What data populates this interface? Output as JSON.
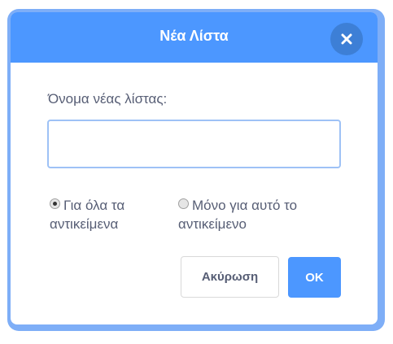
{
  "dialog": {
    "title": "Νέα Λίστα",
    "close_icon": "close-icon",
    "name_label": "Όνομα νέας λίστας:",
    "name_input": {
      "value": "",
      "placeholder": ""
    },
    "options": [
      {
        "label": "Για όλα τα αντικείμενα",
        "selected": true
      },
      {
        "label": "Μόνο για αυτό το αντικείμενο",
        "selected": false
      }
    ],
    "cancel_label": "Ακύρωση",
    "ok_label": "OK"
  },
  "colors": {
    "header": "#4c97ff",
    "frame": "#7eaef7",
    "close_button": "#3d7fd6",
    "text": "#575e75",
    "input_border": "#9ec2f6"
  }
}
